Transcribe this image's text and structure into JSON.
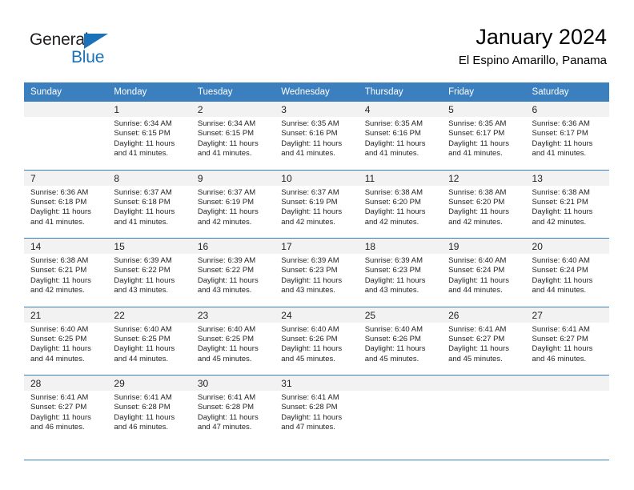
{
  "brand": {
    "name_part1": "General",
    "name_part2": "Blue",
    "triangle_color": "#1b72b8"
  },
  "header": {
    "title": "January 2024",
    "subtitle": "El Espino Amarillo, Panama",
    "accent_color": "#3b7fbf",
    "daynum_row_bg": "#f2f2f2"
  },
  "weekdays": [
    "Sunday",
    "Monday",
    "Tuesday",
    "Wednesday",
    "Thursday",
    "Friday",
    "Saturday"
  ],
  "weeks": [
    {
      "days": [
        {
          "num": "",
          "empty": true,
          "sunrise": "",
          "sunset": "",
          "daylight1": "",
          "daylight2": ""
        },
        {
          "num": "1",
          "sunrise": "Sunrise: 6:34 AM",
          "sunset": "Sunset: 6:15 PM",
          "daylight1": "Daylight: 11 hours",
          "daylight2": "and 41 minutes."
        },
        {
          "num": "2",
          "sunrise": "Sunrise: 6:34 AM",
          "sunset": "Sunset: 6:15 PM",
          "daylight1": "Daylight: 11 hours",
          "daylight2": "and 41 minutes."
        },
        {
          "num": "3",
          "sunrise": "Sunrise: 6:35 AM",
          "sunset": "Sunset: 6:16 PM",
          "daylight1": "Daylight: 11 hours",
          "daylight2": "and 41 minutes."
        },
        {
          "num": "4",
          "sunrise": "Sunrise: 6:35 AM",
          "sunset": "Sunset: 6:16 PM",
          "daylight1": "Daylight: 11 hours",
          "daylight2": "and 41 minutes."
        },
        {
          "num": "5",
          "sunrise": "Sunrise: 6:35 AM",
          "sunset": "Sunset: 6:17 PM",
          "daylight1": "Daylight: 11 hours",
          "daylight2": "and 41 minutes."
        },
        {
          "num": "6",
          "sunrise": "Sunrise: 6:36 AM",
          "sunset": "Sunset: 6:17 PM",
          "daylight1": "Daylight: 11 hours",
          "daylight2": "and 41 minutes."
        }
      ]
    },
    {
      "days": [
        {
          "num": "7",
          "sunrise": "Sunrise: 6:36 AM",
          "sunset": "Sunset: 6:18 PM",
          "daylight1": "Daylight: 11 hours",
          "daylight2": "and 41 minutes."
        },
        {
          "num": "8",
          "sunrise": "Sunrise: 6:37 AM",
          "sunset": "Sunset: 6:18 PM",
          "daylight1": "Daylight: 11 hours",
          "daylight2": "and 41 minutes."
        },
        {
          "num": "9",
          "sunrise": "Sunrise: 6:37 AM",
          "sunset": "Sunset: 6:19 PM",
          "daylight1": "Daylight: 11 hours",
          "daylight2": "and 42 minutes."
        },
        {
          "num": "10",
          "sunrise": "Sunrise: 6:37 AM",
          "sunset": "Sunset: 6:19 PM",
          "daylight1": "Daylight: 11 hours",
          "daylight2": "and 42 minutes."
        },
        {
          "num": "11",
          "sunrise": "Sunrise: 6:38 AM",
          "sunset": "Sunset: 6:20 PM",
          "daylight1": "Daylight: 11 hours",
          "daylight2": "and 42 minutes."
        },
        {
          "num": "12",
          "sunrise": "Sunrise: 6:38 AM",
          "sunset": "Sunset: 6:20 PM",
          "daylight1": "Daylight: 11 hours",
          "daylight2": "and 42 minutes."
        },
        {
          "num": "13",
          "sunrise": "Sunrise: 6:38 AM",
          "sunset": "Sunset: 6:21 PM",
          "daylight1": "Daylight: 11 hours",
          "daylight2": "and 42 minutes."
        }
      ]
    },
    {
      "days": [
        {
          "num": "14",
          "sunrise": "Sunrise: 6:38 AM",
          "sunset": "Sunset: 6:21 PM",
          "daylight1": "Daylight: 11 hours",
          "daylight2": "and 42 minutes."
        },
        {
          "num": "15",
          "sunrise": "Sunrise: 6:39 AM",
          "sunset": "Sunset: 6:22 PM",
          "daylight1": "Daylight: 11 hours",
          "daylight2": "and 43 minutes."
        },
        {
          "num": "16",
          "sunrise": "Sunrise: 6:39 AM",
          "sunset": "Sunset: 6:22 PM",
          "daylight1": "Daylight: 11 hours",
          "daylight2": "and 43 minutes."
        },
        {
          "num": "17",
          "sunrise": "Sunrise: 6:39 AM",
          "sunset": "Sunset: 6:23 PM",
          "daylight1": "Daylight: 11 hours",
          "daylight2": "and 43 minutes."
        },
        {
          "num": "18",
          "sunrise": "Sunrise: 6:39 AM",
          "sunset": "Sunset: 6:23 PM",
          "daylight1": "Daylight: 11 hours",
          "daylight2": "and 43 minutes."
        },
        {
          "num": "19",
          "sunrise": "Sunrise: 6:40 AM",
          "sunset": "Sunset: 6:24 PM",
          "daylight1": "Daylight: 11 hours",
          "daylight2": "and 44 minutes."
        },
        {
          "num": "20",
          "sunrise": "Sunrise: 6:40 AM",
          "sunset": "Sunset: 6:24 PM",
          "daylight1": "Daylight: 11 hours",
          "daylight2": "and 44 minutes."
        }
      ]
    },
    {
      "days": [
        {
          "num": "21",
          "sunrise": "Sunrise: 6:40 AM",
          "sunset": "Sunset: 6:25 PM",
          "daylight1": "Daylight: 11 hours",
          "daylight2": "and 44 minutes."
        },
        {
          "num": "22",
          "sunrise": "Sunrise: 6:40 AM",
          "sunset": "Sunset: 6:25 PM",
          "daylight1": "Daylight: 11 hours",
          "daylight2": "and 44 minutes."
        },
        {
          "num": "23",
          "sunrise": "Sunrise: 6:40 AM",
          "sunset": "Sunset: 6:25 PM",
          "daylight1": "Daylight: 11 hours",
          "daylight2": "and 45 minutes."
        },
        {
          "num": "24",
          "sunrise": "Sunrise: 6:40 AM",
          "sunset": "Sunset: 6:26 PM",
          "daylight1": "Daylight: 11 hours",
          "daylight2": "and 45 minutes."
        },
        {
          "num": "25",
          "sunrise": "Sunrise: 6:40 AM",
          "sunset": "Sunset: 6:26 PM",
          "daylight1": "Daylight: 11 hours",
          "daylight2": "and 45 minutes."
        },
        {
          "num": "26",
          "sunrise": "Sunrise: 6:41 AM",
          "sunset": "Sunset: 6:27 PM",
          "daylight1": "Daylight: 11 hours",
          "daylight2": "and 45 minutes."
        },
        {
          "num": "27",
          "sunrise": "Sunrise: 6:41 AM",
          "sunset": "Sunset: 6:27 PM",
          "daylight1": "Daylight: 11 hours",
          "daylight2": "and 46 minutes."
        }
      ]
    },
    {
      "days": [
        {
          "num": "28",
          "sunrise": "Sunrise: 6:41 AM",
          "sunset": "Sunset: 6:27 PM",
          "daylight1": "Daylight: 11 hours",
          "daylight2": "and 46 minutes."
        },
        {
          "num": "29",
          "sunrise": "Sunrise: 6:41 AM",
          "sunset": "Sunset: 6:28 PM",
          "daylight1": "Daylight: 11 hours",
          "daylight2": "and 46 minutes."
        },
        {
          "num": "30",
          "sunrise": "Sunrise: 6:41 AM",
          "sunset": "Sunset: 6:28 PM",
          "daylight1": "Daylight: 11 hours",
          "daylight2": "and 47 minutes."
        },
        {
          "num": "31",
          "sunrise": "Sunrise: 6:41 AM",
          "sunset": "Sunset: 6:28 PM",
          "daylight1": "Daylight: 11 hours",
          "daylight2": "and 47 minutes."
        },
        {
          "num": "",
          "empty": true,
          "sunrise": "",
          "sunset": "",
          "daylight1": "",
          "daylight2": ""
        },
        {
          "num": "",
          "empty": true,
          "sunrise": "",
          "sunset": "",
          "daylight1": "",
          "daylight2": ""
        },
        {
          "num": "",
          "empty": true,
          "sunrise": "",
          "sunset": "",
          "daylight1": "",
          "daylight2": ""
        }
      ]
    }
  ]
}
